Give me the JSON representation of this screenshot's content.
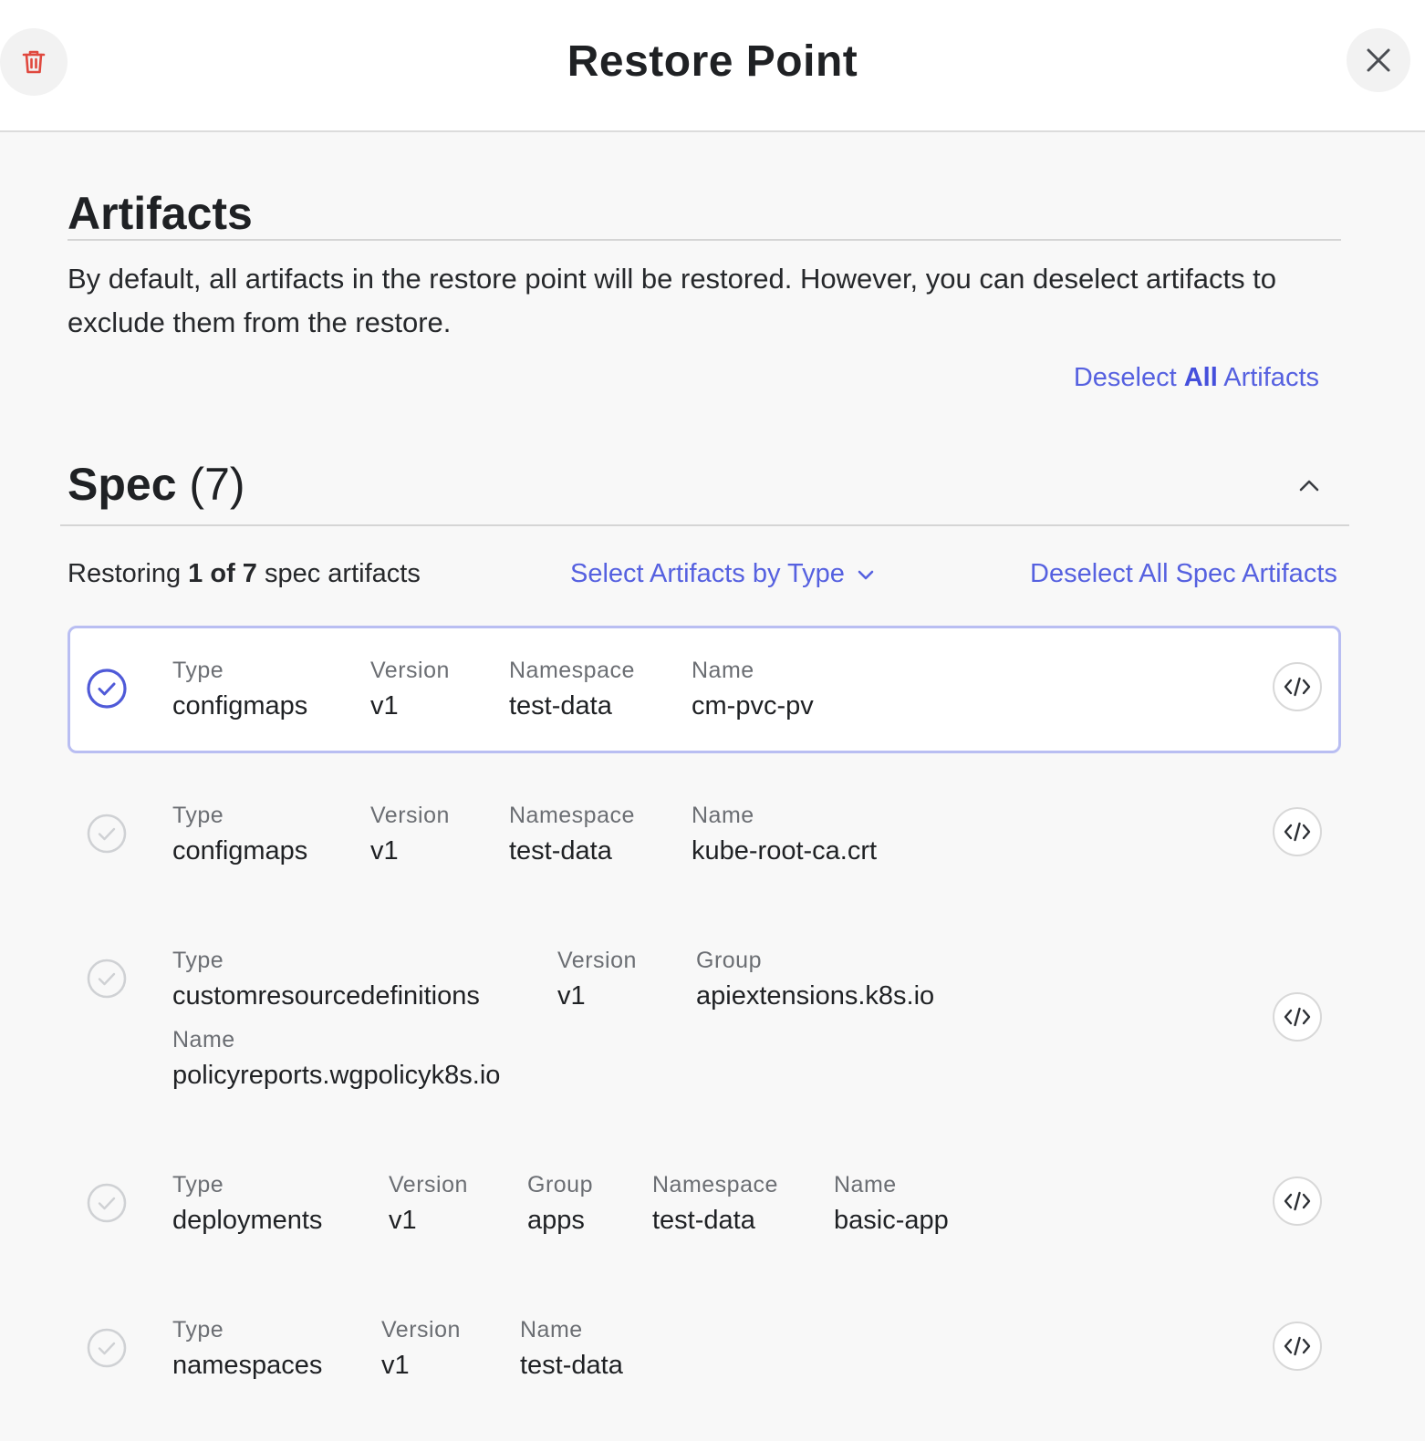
{
  "header": {
    "title": "Restore Point"
  },
  "artifacts_section": {
    "title": "Artifacts",
    "description": "By default, all artifacts in the restore point will be restored. However, you can deselect artifacts to exclude them from the restore.",
    "deselect_all_prefix": "Deselect ",
    "deselect_all_bold": "All",
    "deselect_all_suffix": " Artifacts"
  },
  "spec": {
    "title": "Spec",
    "count": "(7)",
    "restoring_prefix": "Restoring ",
    "restoring_bold": "1 of 7",
    "restoring_suffix": " spec artifacts",
    "select_by_type": "Select Artifacts by Type",
    "deselect_spec": "Deselect All Spec Artifacts"
  },
  "items": [
    {
      "selected": true,
      "fields": [
        {
          "label": "Type",
          "value": "configmaps"
        },
        {
          "label": "Version",
          "value": "v1"
        },
        {
          "label": "Namespace",
          "value": "test-data"
        },
        {
          "label": "Name",
          "value": "cm-pvc-pv"
        }
      ]
    },
    {
      "selected": false,
      "fields": [
        {
          "label": "Type",
          "value": "configmaps"
        },
        {
          "label": "Version",
          "value": "v1"
        },
        {
          "label": "Namespace",
          "value": "test-data"
        },
        {
          "label": "Name",
          "value": "kube-root-ca.crt"
        }
      ]
    },
    {
      "selected": false,
      "fields": [
        {
          "label": "Type",
          "value": "customresourcedefinitions"
        },
        {
          "label": "Version",
          "value": "v1"
        },
        {
          "label": "Group",
          "value": "apiextensions.k8s.io"
        },
        {
          "label": "Name",
          "value": "policyreports.wgpolicyk8s.io"
        }
      ]
    },
    {
      "selected": false,
      "fields": [
        {
          "label": "Type",
          "value": "deployments"
        },
        {
          "label": "Version",
          "value": "v1"
        },
        {
          "label": "Group",
          "value": "apps"
        },
        {
          "label": "Namespace",
          "value": "test-data"
        },
        {
          "label": "Name",
          "value": "basic-app"
        }
      ]
    },
    {
      "selected": false,
      "fields": [
        {
          "label": "Type",
          "value": "namespaces"
        },
        {
          "label": "Version",
          "value": "v1"
        },
        {
          "label": "Name",
          "value": "test-data"
        }
      ]
    }
  ],
  "icons": {
    "delete": "trash-icon",
    "close": "close-icon",
    "collapse": "chevron-up-icon",
    "dropdown": "chevron-down-icon",
    "check": "check-circle-icon",
    "code": "code-icon"
  },
  "colors": {
    "accent": "#5661e0",
    "danger": "#e0483e",
    "selected_border": "#b9bef2"
  }
}
